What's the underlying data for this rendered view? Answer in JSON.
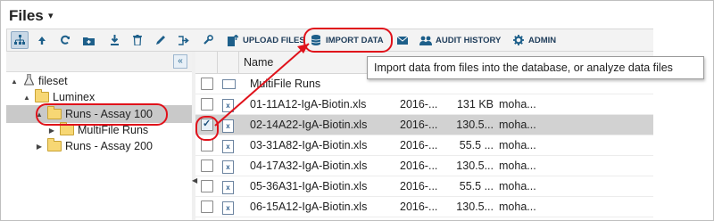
{
  "header": {
    "title": "Files",
    "menu_caret": "▾"
  },
  "toolbar": {
    "icons": [
      "tree-icon",
      "up-icon",
      "refresh-icon",
      "new-folder-icon",
      "download-icon",
      "delete-icon",
      "edit-icon",
      "move-icon",
      "settings-icon"
    ],
    "upload_label": "UPLOAD FILES",
    "import_label": "IMPORT DATA",
    "email_icon": "email-icon",
    "audit_label": "AUDIT HISTORY",
    "admin_label": "ADMIN"
  },
  "tooltip": {
    "text": "Import data from files into the database, or analyze data files"
  },
  "tree": {
    "collapse_glyph": "«",
    "items": [
      {
        "label": "fileset",
        "toggle": "▲",
        "icon": "flask-icon"
      },
      {
        "label": "Luminex",
        "toggle": "▲",
        "icon": "folder-icon"
      },
      {
        "label": "Runs - Assay 100",
        "toggle": "▲",
        "icon": "folder-icon"
      },
      {
        "label": "MultiFile Runs",
        "toggle": "▶",
        "icon": "folder-icon"
      },
      {
        "label": "Runs - Assay 200",
        "toggle": "▶",
        "icon": "folder-icon"
      }
    ]
  },
  "grid": {
    "header_name": "Name",
    "rows": [
      {
        "name": "MultiFile Runs",
        "date": "",
        "size": "",
        "user": "",
        "type": "folder",
        "checked": false
      },
      {
        "name": "01-11A12-IgA-Biotin.xls",
        "date": "2016-...",
        "size": "131 KB",
        "user": "moha...",
        "type": "xls",
        "checked": false
      },
      {
        "name": "02-14A22-IgA-Biotin.xls",
        "date": "2016-...",
        "size": "130.5...",
        "user": "moha...",
        "type": "xls",
        "checked": true
      },
      {
        "name": "03-31A82-IgA-Biotin.xls",
        "date": "2016-...",
        "size": "55.5 ...",
        "user": "moha...",
        "type": "xls",
        "checked": false
      },
      {
        "name": "04-17A32-IgA-Biotin.xls",
        "date": "2016-...",
        "size": "130.5...",
        "user": "moha...",
        "type": "xls",
        "checked": false
      },
      {
        "name": "05-36A31-IgA-Biotin.xls",
        "date": "2016-...",
        "size": "55.5 ...",
        "user": "moha...",
        "type": "xls",
        "checked": false
      },
      {
        "name": "06-15A12-IgA-Biotin.xls",
        "date": "2016-...",
        "size": "130.5...",
        "user": "moha...",
        "type": "xls",
        "checked": false
      }
    ]
  },
  "colors": {
    "annotation": "#e0121b",
    "accent": "#1d5f8a",
    "selected_row": "#d2d2d2"
  }
}
